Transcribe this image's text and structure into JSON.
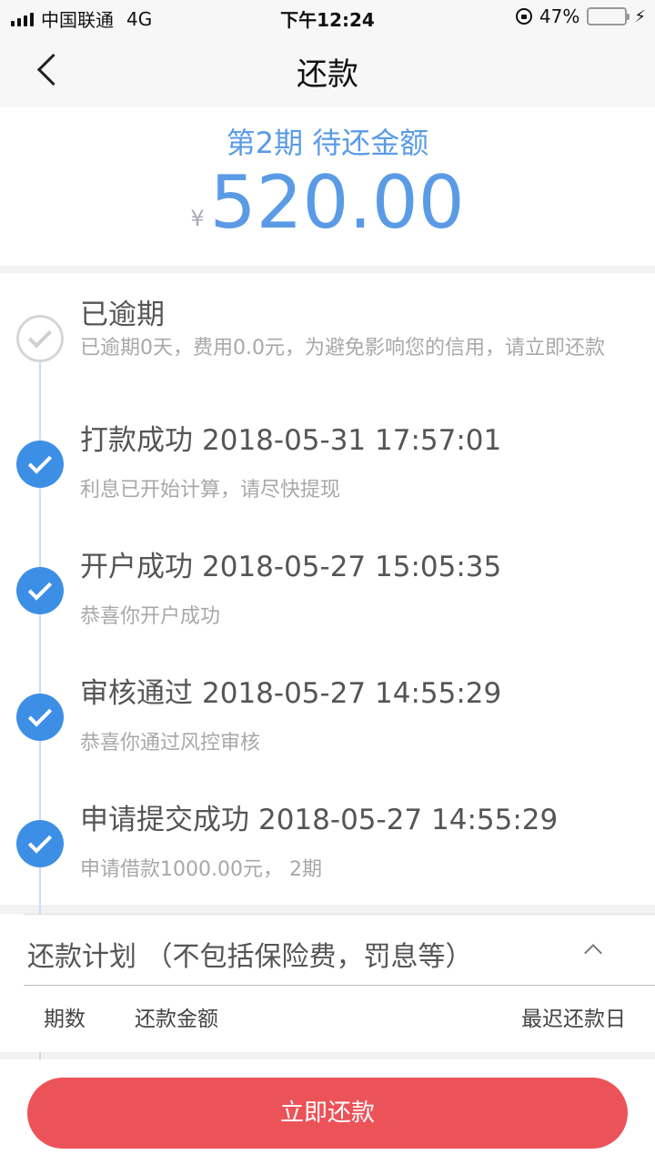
{
  "status_bar": {
    "carrier": "中国联通",
    "network": "4G",
    "time": "下午12:24",
    "battery_percent": "47%",
    "battery_level": 0.47
  },
  "nav": {
    "title": "还款"
  },
  "amount_card": {
    "period_label": "第2期 待还金额",
    "currency": "¥",
    "amount": "520.00",
    "accent_color": "#5b9be6"
  },
  "timeline": [
    {
      "status": "pending",
      "title": "已逾期",
      "time": "",
      "desc": "已逾期0天，费用0.0元，为避免影响您的信用，请立即还款"
    },
    {
      "status": "done",
      "title": "打款成功",
      "time": "2018-05-31 17:57:01",
      "desc": "利息已开始计算，请尽快提现"
    },
    {
      "status": "done",
      "title": "开户成功",
      "time": "2018-05-27 15:05:35",
      "desc": "恭喜你开户成功"
    },
    {
      "status": "done",
      "title": "审核通过",
      "time": "2018-05-27 14:55:29",
      "desc": "恭喜你通过风控审核"
    },
    {
      "status": "done",
      "title": "申请提交成功",
      "time": "2018-05-27 14:55:29",
      "desc": "申请借款1000.00元， 2期"
    }
  ],
  "plan": {
    "header": "还款计划 （不包括保险费，罚息等）",
    "columns": [
      "期数",
      "还款金额",
      "最迟还款日"
    ],
    "toggle_icon": "chevron-up-icon"
  },
  "actions": {
    "repay_label": "立即还款",
    "button_color": "#ec5358"
  }
}
